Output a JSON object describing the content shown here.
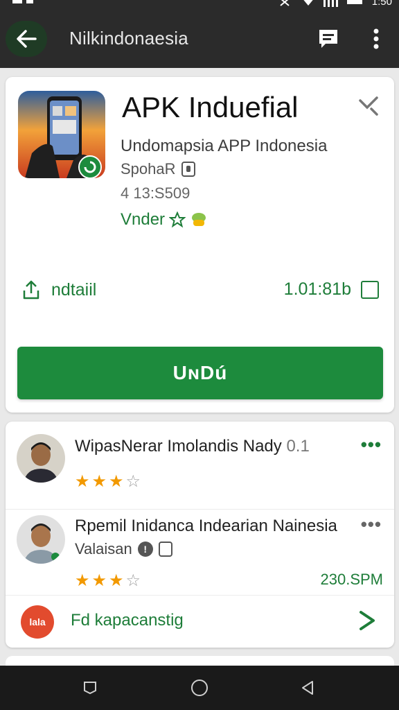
{
  "status_bar": {
    "time": "1:50"
  },
  "app_bar": {
    "title": "Nilkindonaesia"
  },
  "app": {
    "title": "APK Induefial",
    "developer": "Undomapsia APP Indonesia",
    "sponsor_label": "SpohaR",
    "count": "4 13:S509",
    "vendor_label": "Vnder",
    "share_label": "ndtaiil",
    "size": "1.01:81b",
    "install_label": "UɴDú"
  },
  "reviews": [
    {
      "name": "WipasNerar Imolandis Nady",
      "score": "0.1",
      "rating": 3,
      "max_rating": 4
    },
    {
      "name": "Rpemil Inidanca Indearian Nainesia",
      "subtitle": "Valaisan",
      "rating": 3,
      "max_rating": 4,
      "time": "230.SPM"
    }
  ],
  "footer": {
    "logo_text": "lala",
    "label": "Fd kapacanstig"
  },
  "colors": {
    "accent": "#1d8b3d",
    "star": "#f29900",
    "appbar": "#2b2b2b"
  }
}
